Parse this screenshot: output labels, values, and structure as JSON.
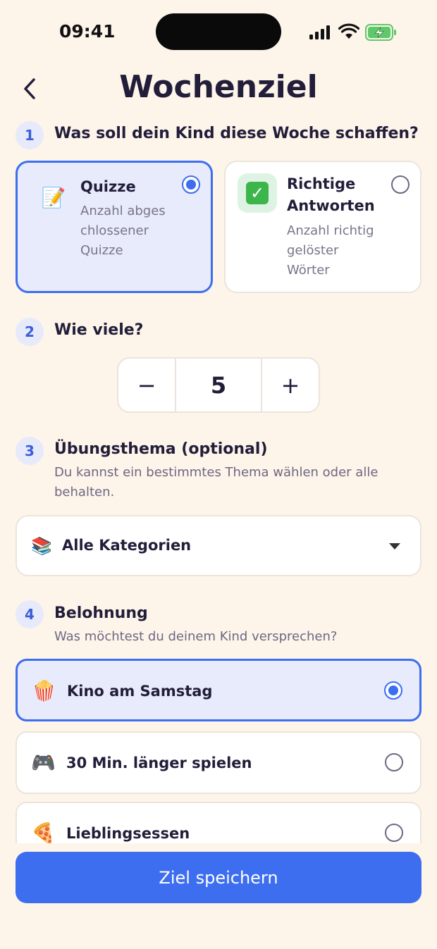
{
  "status_bar": {
    "time": "09:41"
  },
  "header": {
    "title": "Wochenziel"
  },
  "step1": {
    "number": "1",
    "title": "Was soll dein Kind diese Woche schaffen?",
    "options": [
      {
        "icon": "📝",
        "title": "Quizze",
        "desc_lines": [
          "Anzahl abges",
          "chlossener",
          "Quizze"
        ],
        "selected": true
      },
      {
        "icon": "✅",
        "title_lines": [
          "Richtige",
          "Antworten"
        ],
        "desc_lines": [
          "Anzahl richtig",
          "gelöster",
          "Wörter"
        ],
        "selected": false
      }
    ]
  },
  "step2": {
    "number": "2",
    "title": "Wie viele?",
    "minus": "−",
    "value": "5",
    "plus": "+"
  },
  "step3": {
    "number": "3",
    "title": "Übungsthema (optional)",
    "subtitle_lines": [
      "Du kannst ein bestimmtes Thema wählen oder alle",
      "behalten."
    ],
    "select": {
      "icon": "📚",
      "value": "Alle Kategorien"
    }
  },
  "step4": {
    "number": "4",
    "title": "Belohnung",
    "subtitle": "Was möchtest du deinem Kind versprechen?",
    "rewards": [
      {
        "icon": "🍿",
        "label": "Kino am Samstag",
        "selected": true
      },
      {
        "icon": "🎮",
        "label": "30 Min. länger spielen",
        "selected": false
      },
      {
        "icon": "🍕",
        "label": "Lieblingsessen",
        "selected": false
      }
    ]
  },
  "save_button": {
    "label": "Ziel speichern"
  },
  "colors": {
    "accent": "#3d6ef0",
    "background": "#fdf4ea",
    "selected_bg": "#e7ebfb"
  }
}
